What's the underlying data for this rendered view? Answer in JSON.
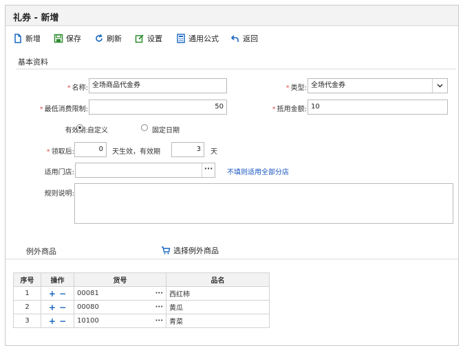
{
  "window": {
    "title": "礼券 - 新增"
  },
  "toolbar": {
    "new_label": "新增",
    "save_label": "保存",
    "refresh_label": "刷新",
    "settings_label": "设置",
    "formula_label": "通用公式",
    "back_label": "返回"
  },
  "basic": {
    "section_title": "基本资料",
    "name_label": "名称:",
    "name_value": "全场商品代金券",
    "type_label": "类型:",
    "type_value": "全场代金券",
    "min_spend_label": "最低消费限制:",
    "min_spend_value": "50",
    "deduct_label": "抵用金额:",
    "deduct_value": "10",
    "validity_label": "有效期:",
    "validity_options": [
      "自定义",
      "固定日期"
    ],
    "after_get_label": "领取后:",
    "effect_days_value": "0",
    "effect_text": "天生效，有效期",
    "valid_days_value": "3",
    "days_unit": "天",
    "store_label": "适用门店:",
    "store_value": "",
    "store_hint": "不填则适用全部分店",
    "rule_label": "规则说明:",
    "rule_value": ""
  },
  "exceptions": {
    "section_title": "例外商品",
    "choose_label": "选择例外商品",
    "columns": [
      "序号",
      "操作",
      "货号",
      "品名"
    ],
    "rows": [
      {
        "seq": "1",
        "code": "00081",
        "name": "西红柿"
      },
      {
        "seq": "2",
        "code": "00080",
        "name": "黄瓜"
      },
      {
        "seq": "3",
        "code": "10100",
        "name": "青菜"
      }
    ]
  },
  "colors": {
    "required": "#d9534f",
    "link": "#1a56c2",
    "icon_blue": "#1565c0",
    "icon_green": "#2e8b2e"
  },
  "icons": {
    "new": "new-doc-icon",
    "save": "save-icon",
    "refresh": "refresh-icon",
    "settings": "edit-icon",
    "formula": "calculator-icon",
    "back": "back-arrow-icon",
    "cart": "cart-icon"
  }
}
